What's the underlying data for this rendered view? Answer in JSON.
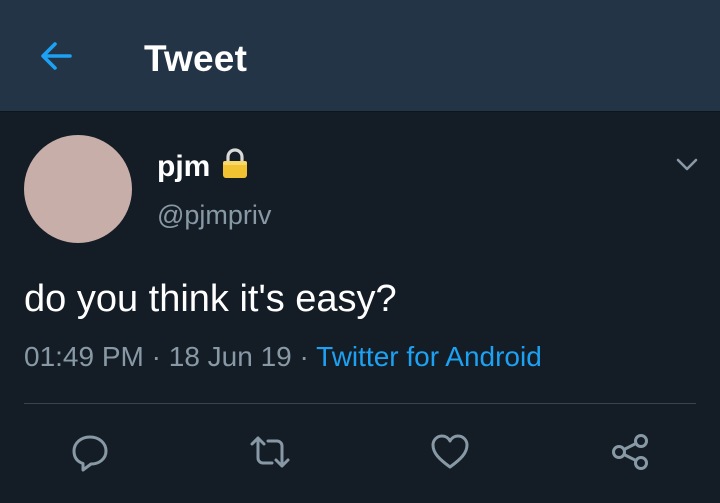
{
  "header": {
    "title": "Tweet",
    "back_icon": "arrow-left-icon",
    "accent_color": "#1da1f2",
    "background_color": "#243447"
  },
  "tweet": {
    "author_name": "pjm",
    "author_handle": "@pjmpriv",
    "protected_icon": "lock-icon",
    "avatar_color": "#c8aea9",
    "text": "do you think it's easy?",
    "time": "01:49 PM",
    "separator": "·",
    "date": "18 Jun 19",
    "source": "Twitter for Android",
    "menu_icon": "chevron-down-icon"
  },
  "actions": [
    {
      "name": "reply",
      "icon": "reply-icon"
    },
    {
      "name": "retweet",
      "icon": "retweet-icon"
    },
    {
      "name": "like",
      "icon": "heart-icon"
    },
    {
      "name": "share",
      "icon": "share-icon"
    }
  ],
  "colors": {
    "background": "#141d26",
    "secondary_text": "#8899a6",
    "divider": "#38444d"
  }
}
